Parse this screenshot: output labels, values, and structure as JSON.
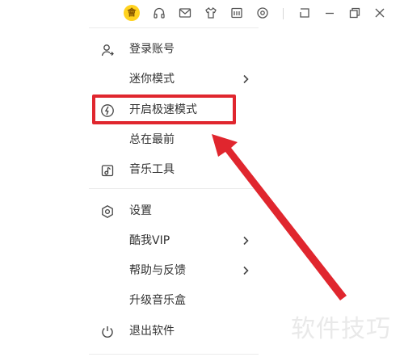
{
  "toolbar": {
    "vip_badge": "會",
    "icons": [
      "vip-icon",
      "headphones-icon",
      "mail-icon",
      "tshirt-icon",
      "player-icon",
      "settings-gear-icon",
      "mini-window-icon",
      "minimize-icon",
      "restore-icon",
      "close-icon"
    ]
  },
  "menu": {
    "items": [
      {
        "label": "登录账号",
        "icon": "user-icon"
      },
      {
        "label": "迷你模式",
        "submenu": true
      },
      {
        "label": "开启极速模式",
        "icon": "speed-icon"
      },
      {
        "label": "总在最前"
      },
      {
        "label": "音乐工具",
        "icon": "music-tools-icon"
      },
      {
        "label": "设置",
        "icon": "settings-icon"
      },
      {
        "label": "酷我VIP",
        "submenu": true
      },
      {
        "label": "帮助与反馈",
        "submenu": true
      },
      {
        "label": "升级音乐盒"
      },
      {
        "label": "退出软件",
        "icon": "power-icon"
      }
    ]
  },
  "annotation": {
    "highlight_color": "#e0262e"
  },
  "watermark": "软件技巧"
}
